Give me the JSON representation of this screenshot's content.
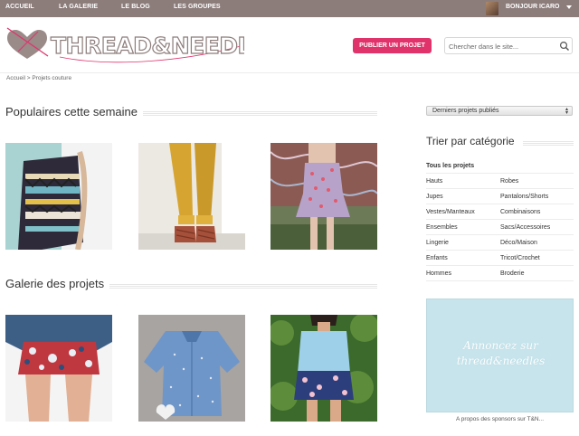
{
  "topnav": {
    "items": [
      "ACCUEIL",
      "LA GALERIE",
      "LE BLOG",
      "LES GROUPES"
    ],
    "greeting": "BONJOUR ICARO"
  },
  "header": {
    "logo_text": "THREAD&NEEDLES",
    "publish_label": "PUBLIER UN PROJET",
    "search_placeholder": "Chercher dans le site..."
  },
  "breadcrumb": "Accueil > Projets couture",
  "main": {
    "popular_title": "Populaires cette semaine",
    "gallery_title": "Galerie des projets"
  },
  "sidebar": {
    "sort_select": "Derniers projets publiés",
    "categories_title": "Trier par catégorie",
    "categories": [
      [
        "Tous les projets",
        ""
      ],
      [
        "Hauts",
        "Robes"
      ],
      [
        "Jupes",
        "Pantalons/Shorts"
      ],
      [
        "Vestes/Manteaux",
        "Combinaisons"
      ],
      [
        "Ensembles",
        "Sacs/Accessoires"
      ],
      [
        "Lingerie",
        "Déco/Maison"
      ],
      [
        "Enfants",
        "Tricot/Crochet"
      ],
      [
        "Hommes",
        "Broderie"
      ]
    ],
    "ad_line1": "Annoncez sur",
    "ad_line2": "thread&needles",
    "ad_caption": "A propos des sponsors sur T&N..."
  },
  "colors": {
    "topnav_bg": "#8c7d7b",
    "accent_pink": "#e0336c",
    "ad_bg": "#c7e4ec"
  },
  "icons": [
    "search-icon",
    "chevron-down-icon",
    "heart-logo-icon"
  ]
}
